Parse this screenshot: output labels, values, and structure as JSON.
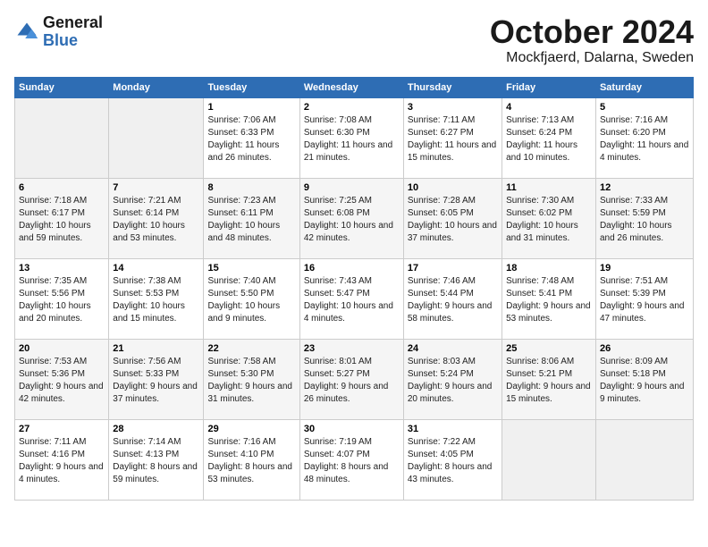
{
  "logo": {
    "text_general": "General",
    "text_blue": "Blue"
  },
  "title": "October 2024",
  "subtitle": "Mockfjaerd, Dalarna, Sweden",
  "headers": [
    "Sunday",
    "Monday",
    "Tuesday",
    "Wednesday",
    "Thursday",
    "Friday",
    "Saturday"
  ],
  "weeks": [
    [
      {
        "day": "",
        "empty": true
      },
      {
        "day": "",
        "empty": true
      },
      {
        "day": "1",
        "sunrise": "7:06 AM",
        "sunset": "6:33 PM",
        "daylight": "11 hours and 26 minutes."
      },
      {
        "day": "2",
        "sunrise": "7:08 AM",
        "sunset": "6:30 PM",
        "daylight": "11 hours and 21 minutes."
      },
      {
        "day": "3",
        "sunrise": "7:11 AM",
        "sunset": "6:27 PM",
        "daylight": "11 hours and 15 minutes."
      },
      {
        "day": "4",
        "sunrise": "7:13 AM",
        "sunset": "6:24 PM",
        "daylight": "11 hours and 10 minutes."
      },
      {
        "day": "5",
        "sunrise": "7:16 AM",
        "sunset": "6:20 PM",
        "daylight": "11 hours and 4 minutes."
      }
    ],
    [
      {
        "day": "6",
        "sunrise": "7:18 AM",
        "sunset": "6:17 PM",
        "daylight": "10 hours and 59 minutes."
      },
      {
        "day": "7",
        "sunrise": "7:21 AM",
        "sunset": "6:14 PM",
        "daylight": "10 hours and 53 minutes."
      },
      {
        "day": "8",
        "sunrise": "7:23 AM",
        "sunset": "6:11 PM",
        "daylight": "10 hours and 48 minutes."
      },
      {
        "day": "9",
        "sunrise": "7:25 AM",
        "sunset": "6:08 PM",
        "daylight": "10 hours and 42 minutes."
      },
      {
        "day": "10",
        "sunrise": "7:28 AM",
        "sunset": "6:05 PM",
        "daylight": "10 hours and 37 minutes."
      },
      {
        "day": "11",
        "sunrise": "7:30 AM",
        "sunset": "6:02 PM",
        "daylight": "10 hours and 31 minutes."
      },
      {
        "day": "12",
        "sunrise": "7:33 AM",
        "sunset": "5:59 PM",
        "daylight": "10 hours and 26 minutes."
      }
    ],
    [
      {
        "day": "13",
        "sunrise": "7:35 AM",
        "sunset": "5:56 PM",
        "daylight": "10 hours and 20 minutes."
      },
      {
        "day": "14",
        "sunrise": "7:38 AM",
        "sunset": "5:53 PM",
        "daylight": "10 hours and 15 minutes."
      },
      {
        "day": "15",
        "sunrise": "7:40 AM",
        "sunset": "5:50 PM",
        "daylight": "10 hours and 9 minutes."
      },
      {
        "day": "16",
        "sunrise": "7:43 AM",
        "sunset": "5:47 PM",
        "daylight": "10 hours and 4 minutes."
      },
      {
        "day": "17",
        "sunrise": "7:46 AM",
        "sunset": "5:44 PM",
        "daylight": "9 hours and 58 minutes."
      },
      {
        "day": "18",
        "sunrise": "7:48 AM",
        "sunset": "5:41 PM",
        "daylight": "9 hours and 53 minutes."
      },
      {
        "day": "19",
        "sunrise": "7:51 AM",
        "sunset": "5:39 PM",
        "daylight": "9 hours and 47 minutes."
      }
    ],
    [
      {
        "day": "20",
        "sunrise": "7:53 AM",
        "sunset": "5:36 PM",
        "daylight": "9 hours and 42 minutes."
      },
      {
        "day": "21",
        "sunrise": "7:56 AM",
        "sunset": "5:33 PM",
        "daylight": "9 hours and 37 minutes."
      },
      {
        "day": "22",
        "sunrise": "7:58 AM",
        "sunset": "5:30 PM",
        "daylight": "9 hours and 31 minutes."
      },
      {
        "day": "23",
        "sunrise": "8:01 AM",
        "sunset": "5:27 PM",
        "daylight": "9 hours and 26 minutes."
      },
      {
        "day": "24",
        "sunrise": "8:03 AM",
        "sunset": "5:24 PM",
        "daylight": "9 hours and 20 minutes."
      },
      {
        "day": "25",
        "sunrise": "8:06 AM",
        "sunset": "5:21 PM",
        "daylight": "9 hours and 15 minutes."
      },
      {
        "day": "26",
        "sunrise": "8:09 AM",
        "sunset": "5:18 PM",
        "daylight": "9 hours and 9 minutes."
      }
    ],
    [
      {
        "day": "27",
        "sunrise": "7:11 AM",
        "sunset": "4:16 PM",
        "daylight": "9 hours and 4 minutes."
      },
      {
        "day": "28",
        "sunrise": "7:14 AM",
        "sunset": "4:13 PM",
        "daylight": "8 hours and 59 minutes."
      },
      {
        "day": "29",
        "sunrise": "7:16 AM",
        "sunset": "4:10 PM",
        "daylight": "8 hours and 53 minutes."
      },
      {
        "day": "30",
        "sunrise": "7:19 AM",
        "sunset": "4:07 PM",
        "daylight": "8 hours and 48 minutes."
      },
      {
        "day": "31",
        "sunrise": "7:22 AM",
        "sunset": "4:05 PM",
        "daylight": "8 hours and 43 minutes."
      },
      {
        "day": "",
        "empty": true
      },
      {
        "day": "",
        "empty": true
      }
    ]
  ],
  "labels": {
    "sunrise": "Sunrise:",
    "sunset": "Sunset:",
    "daylight": "Daylight:"
  }
}
